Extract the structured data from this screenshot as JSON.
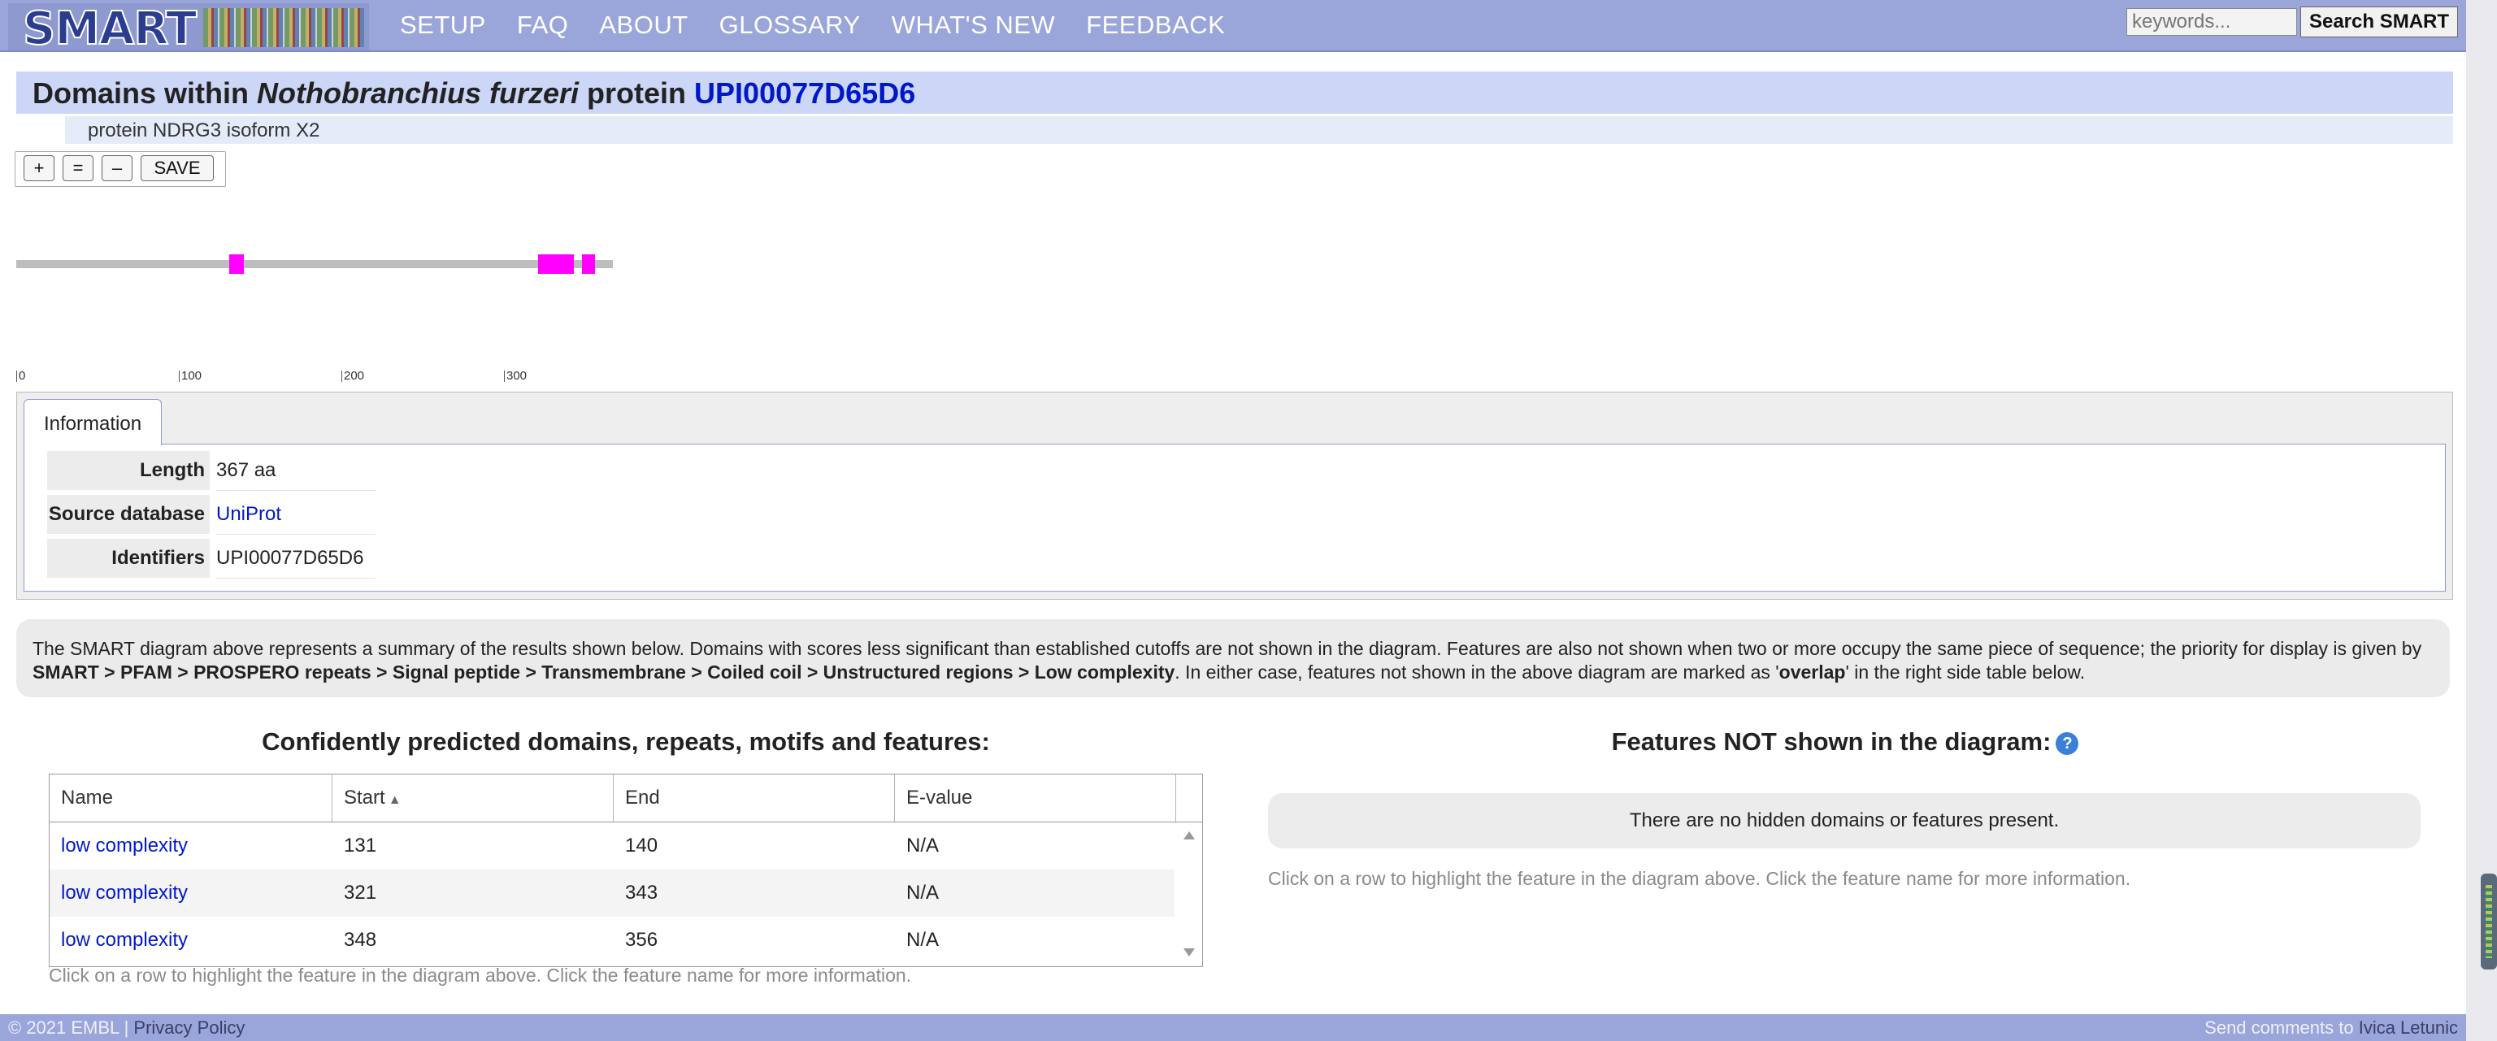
{
  "header": {
    "logo_text": "SMART",
    "nav": [
      "SETUP",
      "FAQ",
      "ABOUT",
      "GLOSSARY",
      "WHAT'S NEW",
      "FEEDBACK"
    ],
    "search_placeholder": "keywords...",
    "search_button": "Search SMART"
  },
  "title": {
    "prefix": "Domains within ",
    "species": "Nothobranchius furzeri",
    "middle": " protein ",
    "protein_id": "UPI00077D65D6",
    "subtitle": "protein NDRG3 isoform X2"
  },
  "toolbar": {
    "zoom_in": "+",
    "reset": "=",
    "zoom_out": "–",
    "save": "SAVE"
  },
  "diagram": {
    "sequence_length": 367,
    "features": [
      {
        "name": "low complexity",
        "start": 131,
        "end": 140
      },
      {
        "name": "low complexity",
        "start": 321,
        "end": 343
      },
      {
        "name": "low complexity",
        "start": 348,
        "end": 356
      }
    ],
    "ticks": [
      "0",
      "100",
      "200",
      "300"
    ],
    "feature_color": "#ff00ff"
  },
  "info": {
    "tab": "Information",
    "rows": [
      {
        "label": "Length",
        "value": "367 aa"
      },
      {
        "label": "Source database",
        "value": "UniProt"
      },
      {
        "label": "Identifiers",
        "value": "UPI00077D65D6"
      }
    ]
  },
  "note": {
    "text1": "The SMART diagram above represents a summary of the results shown below. Domains with scores less significant than established cutoffs are not shown in the diagram. Features are also not shown when two or more occupy the same piece of sequence; the priority for display is given by ",
    "priority": "SMART > PFAM > PROSPERO repeats > Signal peptide > Transmembrane > Coiled coil > Unstructured regions > Low complexity",
    "text2": ". In either case, features not shown in the above diagram are marked as '",
    "overlap": "overlap",
    "text3": "' in the right side table below."
  },
  "left_panel": {
    "heading": "Confidently predicted domains, repeats, motifs and features:",
    "columns": [
      "Name",
      "Start",
      "End",
      "E-value"
    ],
    "sort_indicator": "▲",
    "rows": [
      {
        "name": "low complexity",
        "start": "131",
        "end": "140",
        "evalue": "N/A"
      },
      {
        "name": "low complexity",
        "start": "321",
        "end": "343",
        "evalue": "N/A"
      },
      {
        "name": "low complexity",
        "start": "348",
        "end": "356",
        "evalue": "N/A"
      }
    ],
    "hint": "Click on a row to highlight the feature in the diagram above. Click the feature name for more information."
  },
  "right_panel": {
    "heading": "Features NOT shown in the diagram:",
    "help": "?",
    "empty_message": "There are no hidden domains or features present.",
    "hint": "Click on a row to highlight the feature in the diagram above. Click the feature name for more information."
  },
  "footer": {
    "copyright": "© 2021 EMBL | ",
    "privacy": "Privacy Policy",
    "send_prefix": "Send comments to ",
    "contact": "Ivica Letunic"
  }
}
